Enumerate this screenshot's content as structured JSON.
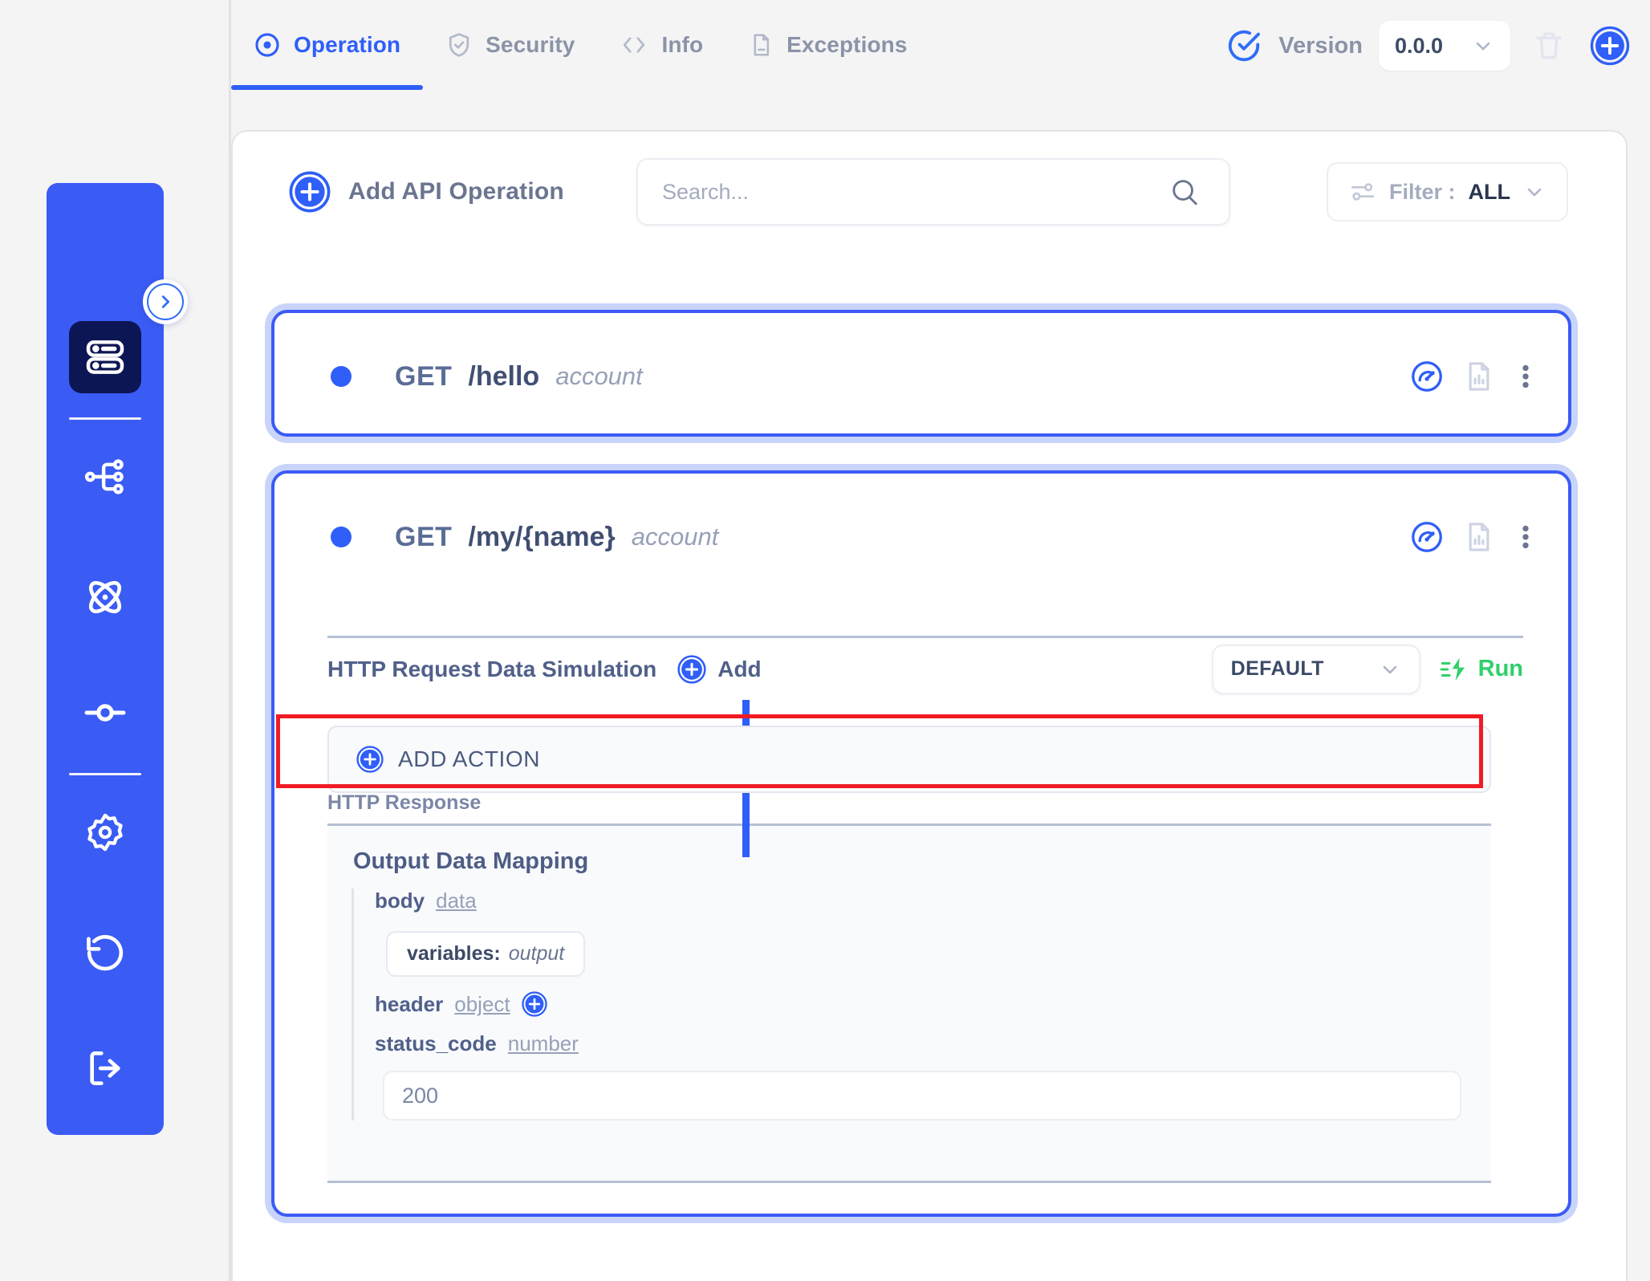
{
  "header": {
    "tabs": [
      {
        "label": "Operation",
        "icon": "target-icon",
        "active": true
      },
      {
        "label": "Security",
        "icon": "shield-check-icon",
        "active": false
      },
      {
        "label": "Info",
        "icon": "code-brackets-icon",
        "active": false
      },
      {
        "label": "Exceptions",
        "icon": "document-alert-icon",
        "active": false
      }
    ],
    "version": {
      "icon": "check-circle-icon",
      "label": "Version",
      "value": "0.0.0",
      "chevron": "chevron-down-icon",
      "delete_icon": "trash-icon",
      "add_icon": "plus-circle-icon"
    }
  },
  "sidebar": {
    "logo": "app-logo",
    "toggle": "chevron-right-icon",
    "items": [
      {
        "name": "sidebar-item-database",
        "icon": "database-icon",
        "active": true
      },
      {
        "name": "sidebar-item-flow",
        "icon": "sitemap-icon",
        "active": false
      },
      {
        "name": "sidebar-item-atom",
        "icon": "atom-icon",
        "active": false
      },
      {
        "name": "sidebar-item-pipeline",
        "icon": "node-line-icon",
        "active": false
      },
      {
        "name": "sidebar-item-settings",
        "icon": "gear-icon",
        "active": false
      },
      {
        "name": "sidebar-item-history",
        "icon": "history-icon",
        "active": false
      },
      {
        "name": "sidebar-item-logout",
        "icon": "logout-icon",
        "active": false
      }
    ]
  },
  "toolbar": {
    "add_operation_label": "Add API Operation",
    "add_operation_icon": "plus-circle-icon",
    "search": {
      "value": "",
      "placeholder": "Search...",
      "icon": "search-icon"
    },
    "filter": {
      "icon": "sliders-icon",
      "label": "Filter :",
      "value": "ALL",
      "chevron": "chevron-down-icon"
    }
  },
  "operations": [
    {
      "method": "GET",
      "path": "/hello",
      "tag": "account",
      "status_dot_color": "#2f5ef8",
      "actions": [
        "gauge-icon",
        "report-file-icon",
        "more-vertical-icon"
      ]
    },
    {
      "method": "GET",
      "path": "/my/{name}",
      "tag": "account",
      "status_dot_color": "#2f5ef8",
      "actions": [
        "gauge-icon",
        "report-file-icon",
        "more-vertical-icon"
      ]
    }
  ],
  "simulation": {
    "title": "HTTP Request Data Simulation",
    "add_label": "Add",
    "add_icon": "plus-circle-icon",
    "profile": "DEFAULT",
    "profile_chevron": "chevron-down-icon",
    "run_label": "Run",
    "run_icon": "lightning-run-icon"
  },
  "add_action": {
    "label": "ADD ACTION",
    "icon": "plus-circle-icon",
    "highlighted": true,
    "highlight_color": "#f01b24"
  },
  "http_response": {
    "title": "HTTP Response",
    "output_mapping_title": "Output Data Mapping",
    "fields": [
      {
        "key": "body",
        "type": "data"
      },
      {
        "key": "header",
        "type": "object",
        "add_icon": "plus-circle-icon"
      },
      {
        "key": "status_code",
        "type": "number"
      }
    ],
    "body_chip": {
      "key": "variables:",
      "value": "output"
    },
    "status_code_value": "200"
  },
  "colors": {
    "brand_blue": "#3b5bf5",
    "accent_blue": "#2f5ef8",
    "halo_blue": "#c9d4fb",
    "run_green": "#2fd06a",
    "highlight_red": "#f01b24",
    "page_bg": "#f4f4f5",
    "muted_text": "#8b93a7"
  }
}
